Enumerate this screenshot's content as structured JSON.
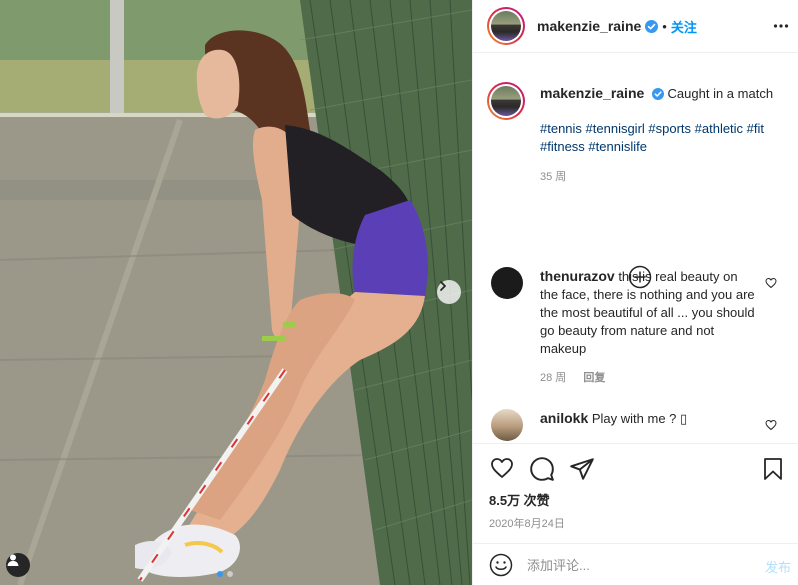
{
  "post": {
    "username": "makenzie_raine",
    "separator": "•",
    "follow_label": "关注",
    "caption": "Caught in a match",
    "hashtags": "#tennis #tennisgirl #sports #athletic #fit #fitness #tennislife",
    "caption_age": "35 周",
    "likes": "8.5万 次赞",
    "date": "2020年8月24日"
  },
  "comments": [
    {
      "username": "thenurazov",
      "text": "this is real beauty on the face, there is nothing and you are the most beautiful of all ... you should go beauty from nature and not makeup",
      "age": "28 周",
      "reply_label": "回复"
    },
    {
      "username": "anilokk",
      "text": "Play with me ? ▯"
    }
  ],
  "composer": {
    "placeholder": "添加评论...",
    "post_label": "发布"
  },
  "colors": {
    "verified": "#3897f0",
    "link": "#0095f6",
    "hashtag": "#00376b",
    "muted": "#8e8e8e"
  },
  "icons": [
    "chevron-right-icon",
    "user-tag-icon",
    "verified-icon",
    "more-icon",
    "add-circle-icon",
    "heart-icon",
    "comment-icon",
    "share-icon",
    "bookmark-icon",
    "emoji-icon"
  ]
}
